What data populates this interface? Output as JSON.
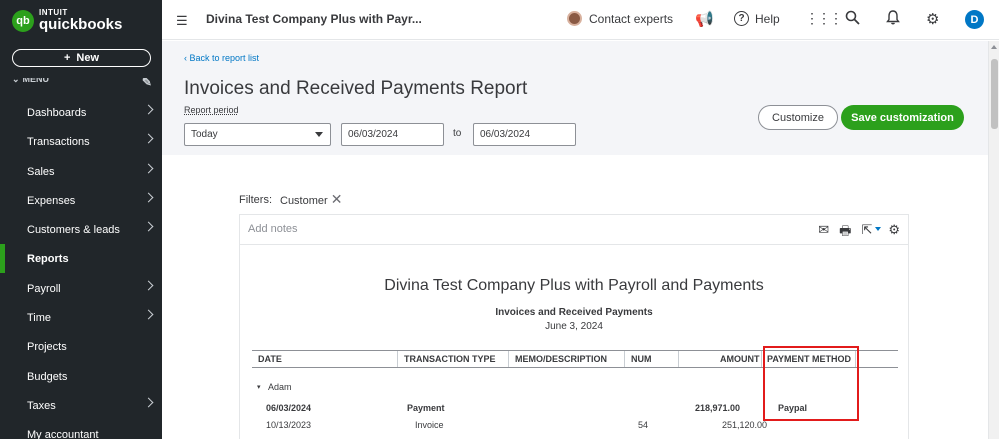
{
  "sidebar": {
    "logo_intuit": "INTUIT",
    "logo_product": "quickbooks",
    "logo_mark": "qb",
    "new_button": "New",
    "menu_label": "MENU",
    "items": [
      {
        "label": "Dashboards",
        "has_arrow": true
      },
      {
        "label": "Transactions",
        "has_arrow": true
      },
      {
        "label": "Sales",
        "has_arrow": true
      },
      {
        "label": "Expenses",
        "has_arrow": true
      },
      {
        "label": "Customers & leads",
        "has_arrow": true
      },
      {
        "label": "Reports",
        "has_arrow": false,
        "active": true
      },
      {
        "label": "Payroll",
        "has_arrow": true
      },
      {
        "label": "Time",
        "has_arrow": true
      },
      {
        "label": "Projects",
        "has_arrow": false
      },
      {
        "label": "Budgets",
        "has_arrow": false
      },
      {
        "label": "Taxes",
        "has_arrow": true
      },
      {
        "label": "My accountant",
        "has_arrow": false
      }
    ],
    "colors": {
      "background": "#21262a",
      "accent": "#2ca01c"
    }
  },
  "topbar": {
    "company_name": "Divina Test Company Plus with Payr...",
    "contact_experts": "Contact experts",
    "help": "Help",
    "user_initial": "D"
  },
  "header": {
    "back_link": "Back to report list",
    "title": "Invoices and Received Payments Report",
    "report_period_label": "Report period",
    "period_value": "Today",
    "date_from": "06/03/2024",
    "to_label": "to",
    "date_to": "06/03/2024",
    "customize_button": "Customize",
    "save_button": "Save customization"
  },
  "filters": {
    "label": "Filters:",
    "chip": "Customer"
  },
  "report": {
    "add_notes": "Add notes",
    "company": "Divina Test Company Plus with Payroll and Payments",
    "name": "Invoices and Received Payments",
    "date": "June 3, 2024",
    "columns": [
      "DATE",
      "TRANSACTION TYPE",
      "MEMO/DESCRIPTION",
      "NUM",
      "AMOUNT",
      "PAYMENT METHOD"
    ],
    "group": "Adam",
    "rows": [
      {
        "date": "06/03/2024",
        "type": "Payment",
        "memo": "",
        "num": "",
        "amount": "218,971.00",
        "method": "Paypal",
        "bold": true
      },
      {
        "date": "10/13/2023",
        "type": "Invoice",
        "memo": "",
        "num": "54",
        "amount": "251,120.00",
        "method": "",
        "bold": false
      }
    ]
  },
  "highlight_color": "#e21b1b"
}
